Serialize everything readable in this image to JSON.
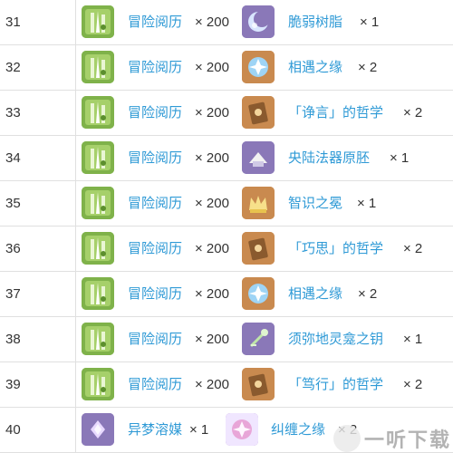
{
  "rows": [
    {
      "level": "31",
      "item1": {
        "name": "冒险阅历",
        "qty": "× 200",
        "icon": "adventure-exp-icon"
      },
      "item2": {
        "name": "脆弱树脂",
        "qty": "× 1",
        "icon": "fragile-resin-icon"
      }
    },
    {
      "level": "32",
      "item1": {
        "name": "冒险阅历",
        "qty": "× 200",
        "icon": "adventure-exp-icon"
      },
      "item2": {
        "name": "相遇之缘",
        "qty": "× 2",
        "icon": "acquaint-fate-icon"
      }
    },
    {
      "level": "33",
      "item1": {
        "name": "冒险阅历",
        "qty": "× 200",
        "icon": "adventure-exp-icon"
      },
      "item2": {
        "name": "「诤言」的哲学",
        "qty": "× 2",
        "icon": "philosophies-book-icon"
      }
    },
    {
      "level": "34",
      "item1": {
        "name": "冒险阅历",
        "qty": "× 200",
        "icon": "adventure-exp-icon"
      },
      "item2": {
        "name": "央陆法器原胚",
        "qty": "× 1",
        "icon": "catalyst-billet-icon"
      }
    },
    {
      "level": "35",
      "item1": {
        "name": "冒险阅历",
        "qty": "× 200",
        "icon": "adventure-exp-icon"
      },
      "item2": {
        "name": "智识之冕",
        "qty": "× 1",
        "icon": "crown-icon"
      }
    },
    {
      "level": "36",
      "item1": {
        "name": "冒险阅历",
        "qty": "× 200",
        "icon": "adventure-exp-icon"
      },
      "item2": {
        "name": "「巧思」的哲学",
        "qty": "× 2",
        "icon": "philosophies-book-icon"
      }
    },
    {
      "level": "37",
      "item1": {
        "name": "冒险阅历",
        "qty": "× 200",
        "icon": "adventure-exp-icon"
      },
      "item2": {
        "name": "相遇之缘",
        "qty": "× 2",
        "icon": "acquaint-fate-icon"
      }
    },
    {
      "level": "38",
      "item1": {
        "name": "冒险阅历",
        "qty": "× 200",
        "icon": "adventure-exp-icon"
      },
      "item2": {
        "name": "须弥地灵龛之钥",
        "qty": "× 1",
        "icon": "sumeru-key-icon"
      }
    },
    {
      "level": "39",
      "item1": {
        "name": "冒险阅历",
        "qty": "× 200",
        "icon": "adventure-exp-icon"
      },
      "item2": {
        "name": "「笃行」的哲学",
        "qty": "× 2",
        "icon": "philosophies-book-icon"
      }
    },
    {
      "level": "40",
      "item1": {
        "name": "异梦溶媒",
        "qty": "× 1",
        "icon": "dream-solvent-icon"
      },
      "item2": {
        "name": "纠缠之缘",
        "qty": "× 2",
        "icon": "intertwined-fate-icon"
      }
    }
  ],
  "watermark": {
    "text": "一听下载"
  },
  "colors": {
    "link": "#2f9ad6",
    "text": "#333333",
    "border": "#e0e0e0",
    "icon_green_bg": "#7fb24a",
    "icon_purple_bg": "#8a78b8",
    "icon_orange_bg": "#c98a4f"
  }
}
